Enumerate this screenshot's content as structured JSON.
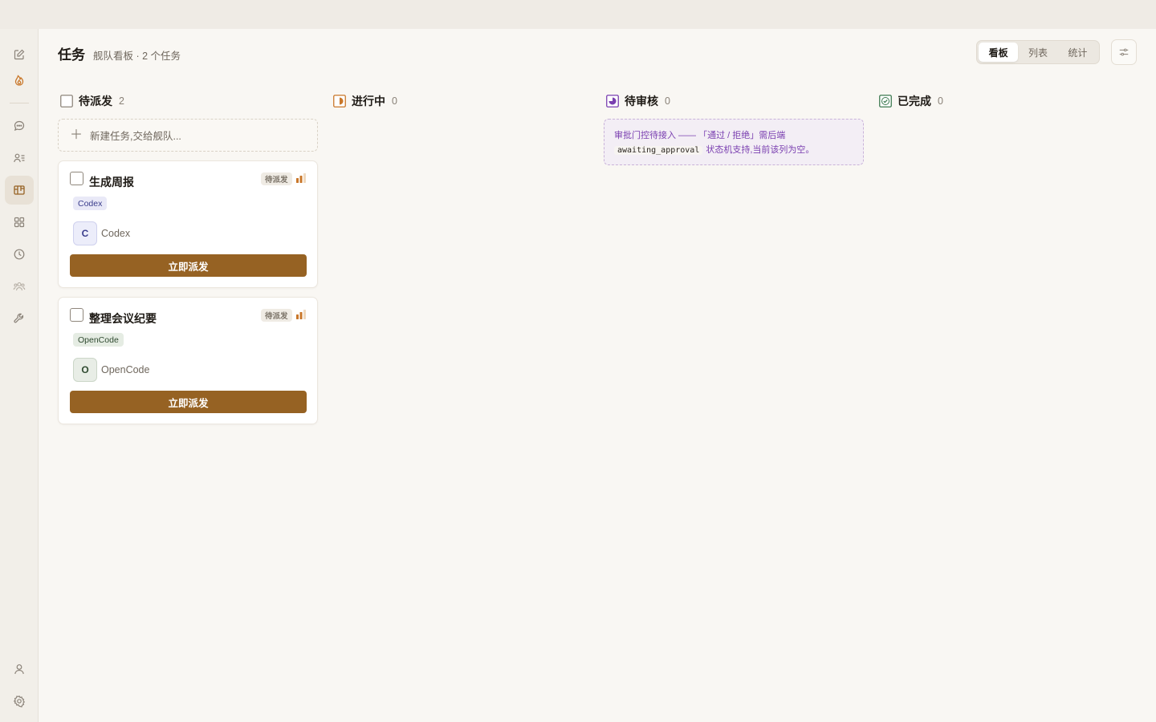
{
  "rail": {
    "top": [
      "edit-icon",
      "flame-icon"
    ],
    "items": [
      "chat-icon",
      "contacts-icon",
      "kanban-icon",
      "grid-icon",
      "clock-icon",
      "team-icon",
      "wrench-icon"
    ],
    "bottom": [
      "user-icon",
      "gear-icon"
    ],
    "active": "kanban-icon"
  },
  "header": {
    "title": "任务",
    "subtitle": "舰队看板 · 2 个任务",
    "views": [
      "看板",
      "列表",
      "统计"
    ],
    "active_view": "看板"
  },
  "colors": {
    "accent": "#966223",
    "review": "#7a3fb0",
    "done": "#3d7a50",
    "progress": "#c9772a"
  },
  "columns": {
    "todo": {
      "title": "待派发",
      "count": "2",
      "new_task": "新建任务,交给舰队...",
      "cards": [
        {
          "title": "生成周报",
          "status": "待派发",
          "tag": "Codex",
          "avatar": "C",
          "agent": "Codex",
          "button": "立即派发"
        },
        {
          "title": "整理会议纪要",
          "status": "待派发",
          "tag": "OpenCode",
          "avatar": "O",
          "agent": "OpenCode",
          "button": "立即派发"
        }
      ]
    },
    "progress": {
      "title": "进行中",
      "count": "0"
    },
    "review": {
      "title": "待审核",
      "count": "0",
      "note_line1": "审批门控待接入 —— 「通过 / 拒绝」需后端",
      "note_code": "awaiting_approval",
      "note_line2": "状态机支持,当前该列为空。"
    },
    "done": {
      "title": "已完成",
      "count": "0"
    }
  }
}
